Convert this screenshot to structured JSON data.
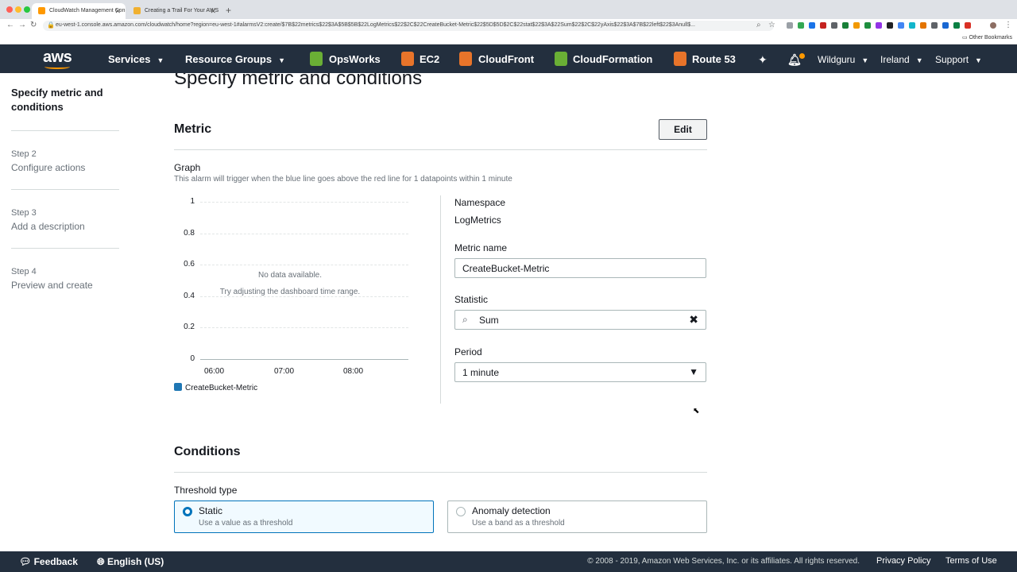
{
  "browser": {
    "tabs": [
      {
        "title": "CloudWatch Management Con"
      },
      {
        "title": "Creating a Trail For Your AWS"
      }
    ],
    "url": "eu-west-1.console.aws.amazon.com/cloudwatch/home?region=eu-west-1#alarmsV2:create/$7B$22metrics$22$3A$5B$5B$22LogMetrics$22$2C$22CreateBucket-Metric$22$5D$5D$2C$22stat$22$3A$22Sum$22$2C$22yAxis$22$3A$7B$22left$22$3Anull$...",
    "other_bookmarks": "Other Bookmarks"
  },
  "awsnav": {
    "logo": "aws",
    "services": "Services",
    "resource_groups": "Resource Groups",
    "shortcuts": [
      "OpsWorks",
      "EC2",
      "CloudFront",
      "CloudFormation",
      "Route 53"
    ],
    "user": "Wildguru",
    "region": "Ireland",
    "support": "Support"
  },
  "steps": {
    "current": "Specify metric and conditions",
    "list": [
      {
        "num": "Step 2",
        "label": "Configure actions"
      },
      {
        "num": "Step 3",
        "label": "Add a description"
      },
      {
        "num": "Step 4",
        "label": "Preview and create"
      }
    ]
  },
  "page": {
    "title": "Specify metric and conditions"
  },
  "metric": {
    "title": "Metric",
    "edit": "Edit",
    "graph_label": "Graph",
    "graph_desc": "This alarm will trigger when the blue line goes above the red line for 1 datapoints within 1 minute",
    "namespace_label": "Namespace",
    "namespace_value": "LogMetrics",
    "metric_name_label": "Metric name",
    "metric_name_value": "CreateBucket-Metric",
    "statistic_label": "Statistic",
    "statistic_value": "Sum",
    "period_label": "Period",
    "period_value": "1 minute"
  },
  "chart_data": {
    "type": "line",
    "y_ticks": [
      "1",
      "0.8",
      "0.6",
      "0.4",
      "0.2",
      "0"
    ],
    "x_ticks": [
      "06:00",
      "07:00",
      "08:00"
    ],
    "ylim": [
      0,
      1
    ],
    "series": [
      {
        "name": "CreateBucket-Metric",
        "values": []
      }
    ],
    "empty_message": "No data available.",
    "empty_hint": "Try adjusting the dashboard time range.",
    "series_color": "#1f77b4"
  },
  "conditions": {
    "title": "Conditions",
    "threshold_label": "Threshold type",
    "static_title": "Static",
    "static_desc": "Use a value as a threshold",
    "anomaly_title": "Anomaly detection",
    "anomaly_desc": "Use a band as a threshold"
  },
  "footer": {
    "feedback": "Feedback",
    "language": "English (US)",
    "copyright": "© 2008 - 2019, Amazon Web Services, Inc. or its affiliates. All rights reserved.",
    "privacy": "Privacy Policy",
    "terms": "Terms of Use"
  },
  "colors": {
    "nav_bg": "#232f3e",
    "accent": "#0073bb",
    "aws_orange": "#ff9900"
  }
}
